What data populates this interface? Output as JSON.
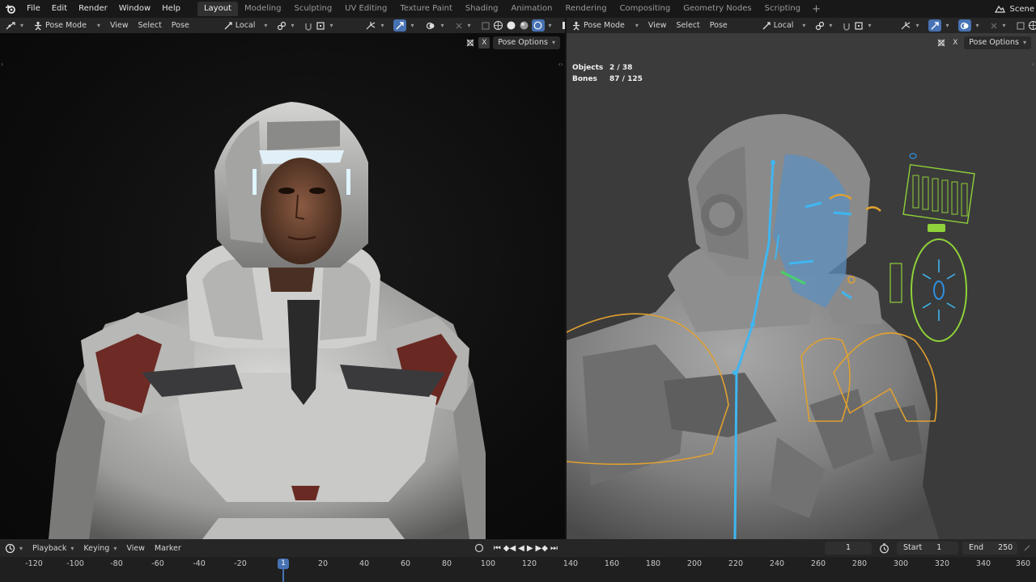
{
  "app": {
    "menu": [
      "File",
      "Edit",
      "Render",
      "Window",
      "Help"
    ],
    "workspaces": [
      "Layout",
      "Modeling",
      "Sculpting",
      "UV Editing",
      "Texture Paint",
      "Shading",
      "Animation",
      "Rendering",
      "Compositing",
      "Geometry Nodes",
      "Scripting"
    ],
    "active_workspace": "Layout",
    "add_workspace": "+",
    "scene_label": "Scene"
  },
  "left_viewport": {
    "mode": "Pose Mode",
    "menus": [
      "View",
      "Select",
      "Pose"
    ],
    "transform_orientation": "Local",
    "pose_options": "Pose Options",
    "x_toggle": "X"
  },
  "right_viewport": {
    "mode": "Pose Mode",
    "menus": [
      "View",
      "Select",
      "Pose"
    ],
    "transform_orientation": "Local",
    "pose_options": "Pose Options",
    "x_toggle": "X",
    "stats": {
      "objects_label": "Objects",
      "objects_value": "2 / 38",
      "bones_label": "Bones",
      "bones_value": "87 / 125"
    }
  },
  "timeline": {
    "menus": [
      "Playback",
      "Keying",
      "View",
      "Marker"
    ],
    "current_frame": "1",
    "start_label": "Start",
    "start_value": "1",
    "end_label": "End",
    "end_value": "250",
    "ruler_labels": [
      "-120",
      "-100",
      "-80",
      "-60",
      "-40",
      "-20",
      "1",
      "20",
      "40",
      "60",
      "80",
      "100",
      "120",
      "140",
      "160",
      "180",
      "200",
      "220",
      "240",
      "260",
      "280",
      "300",
      "320",
      "340",
      "360"
    ],
    "playhead_label": "1"
  },
  "colors": {
    "accent": "#4772b3",
    "bone_blue": "#3fb6f0",
    "ik_yellow": "#e0a030",
    "control_green": "#8fd13a"
  }
}
